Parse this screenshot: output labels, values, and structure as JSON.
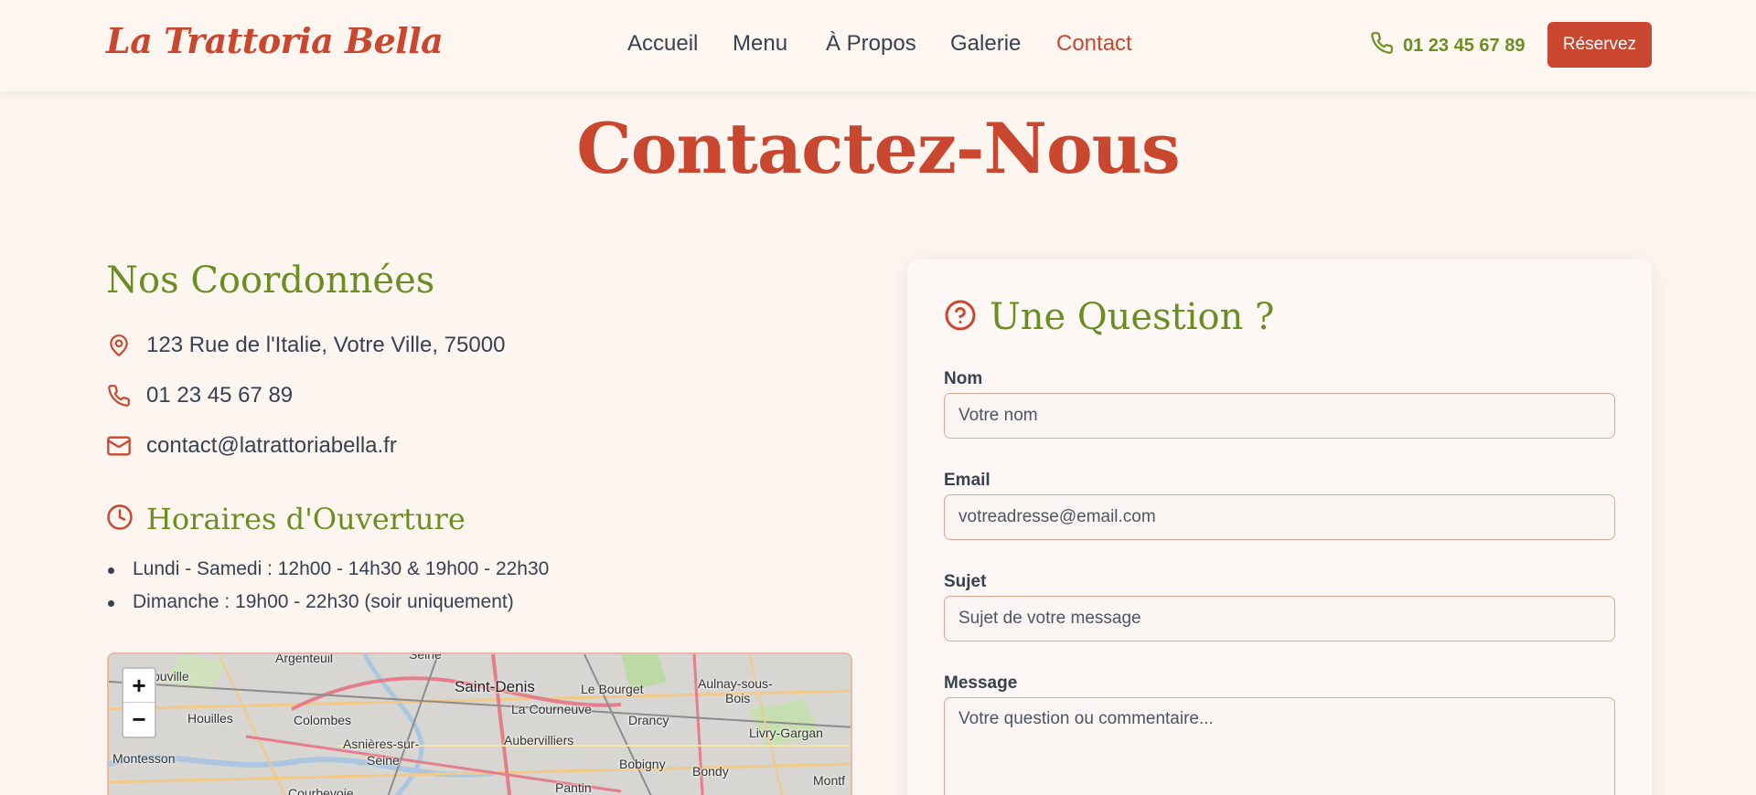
{
  "header": {
    "logo": "La Trattoria Bella",
    "nav": [
      {
        "label": "Accueil",
        "active": false
      },
      {
        "label": "Menu",
        "active": false
      },
      {
        "label": "À Propos",
        "active": false
      },
      {
        "label": "Galerie",
        "active": false
      },
      {
        "label": "Contact",
        "active": true
      }
    ],
    "phone": "01 23 45 67 89",
    "reserve_label": "Réservez"
  },
  "page": {
    "title": "Contactez-Nous"
  },
  "coordinates": {
    "title": "Nos Coordonnées",
    "address": "123 Rue de l'Italie, Votre Ville, 75000",
    "phone": "01 23 45 67 89",
    "email": "contact@latrattoriabella.fr"
  },
  "hours": {
    "title": "Horaires d'Ouverture",
    "items": [
      "Lundi - Samedi : 12h00 - 14h30 & 19h00 - 22h30",
      "Dimanche : 19h00 - 22h30 (soir uniquement)"
    ]
  },
  "map": {
    "zoom_in": "+",
    "zoom_out": "−",
    "places": [
      "Argenteuil",
      "Seine",
      "Saint-Denis",
      "Le Bourget",
      "Aulnay-sous-",
      "Bois",
      "ouville",
      "Houilles",
      "Colombes",
      "La Courneuve",
      "Drancy",
      "Livry-Gargan",
      "Asnières-sur-",
      "Seine",
      "Aubervilliers",
      "Montesson",
      "Bobigny",
      "Bondy",
      "Montf",
      "Courbevoie",
      "Pantin"
    ]
  },
  "form": {
    "title": "Une Question ?",
    "name": {
      "label": "Nom",
      "placeholder": "Votre nom"
    },
    "email": {
      "label": "Email",
      "placeholder": "votreadresse@email.com"
    },
    "subject": {
      "label": "Sujet",
      "placeholder": "Sujet de votre message"
    },
    "message": {
      "label": "Message",
      "placeholder": "Votre question ou commentaire..."
    }
  },
  "colors": {
    "brand": "#c9472f",
    "accent_green": "#6b8e23",
    "background": "#fdf5f0",
    "text": "#374151"
  },
  "icons": {
    "header_phone": "phone-icon",
    "address": "map-pin-icon",
    "phone": "phone-icon",
    "email": "mail-icon",
    "hours": "clock-icon",
    "form": "question-circle-icon"
  }
}
